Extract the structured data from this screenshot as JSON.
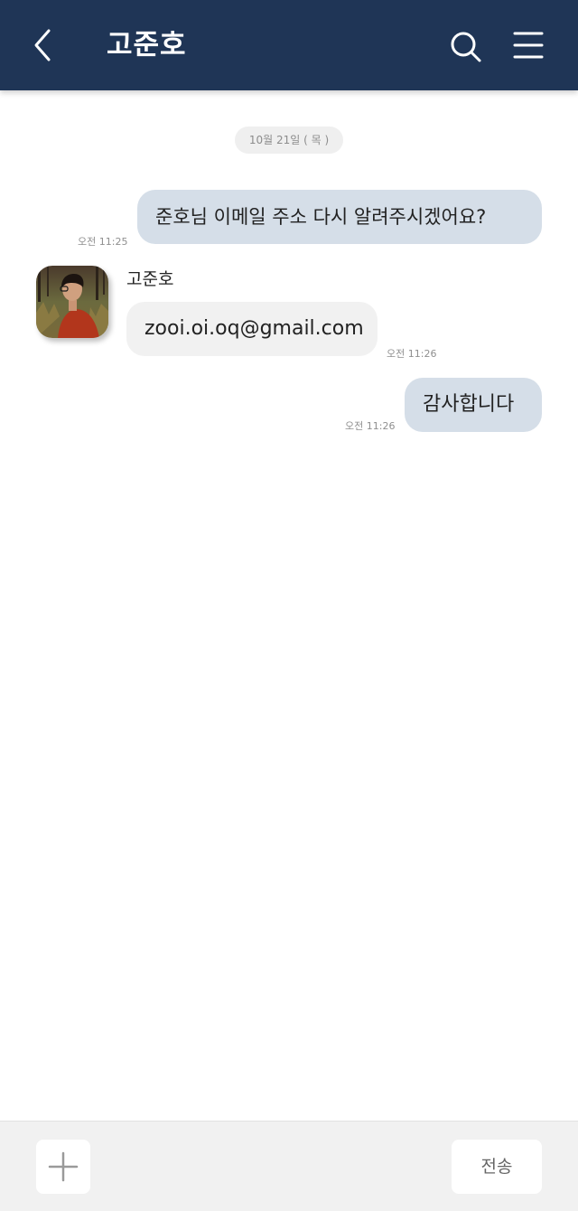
{
  "header": {
    "title": "고준호",
    "back_icon": "chevron-left-icon",
    "search_icon": "search-icon",
    "menu_icon": "hamburger-menu-icon",
    "background_color": "#1f3556"
  },
  "chat": {
    "date_label": "10월 21일 ( 목 )",
    "messages": [
      {
        "sender": "me",
        "text": "준호님 이메일 주소 다시 알려주시겠어요?",
        "time": "오전 11:25"
      },
      {
        "sender": "고준호",
        "text": "zooi.oi.oq@gmail.com",
        "time": "오전 11:26"
      },
      {
        "sender": "me",
        "text": "감사합니다",
        "time": "오전 11:26"
      }
    ],
    "colors": {
      "my_bubble": "#d5dee8",
      "their_bubble": "#f1f1f1"
    }
  },
  "input_bar": {
    "plus_icon": "plus-icon",
    "input_value": "",
    "send_label": "전송"
  }
}
